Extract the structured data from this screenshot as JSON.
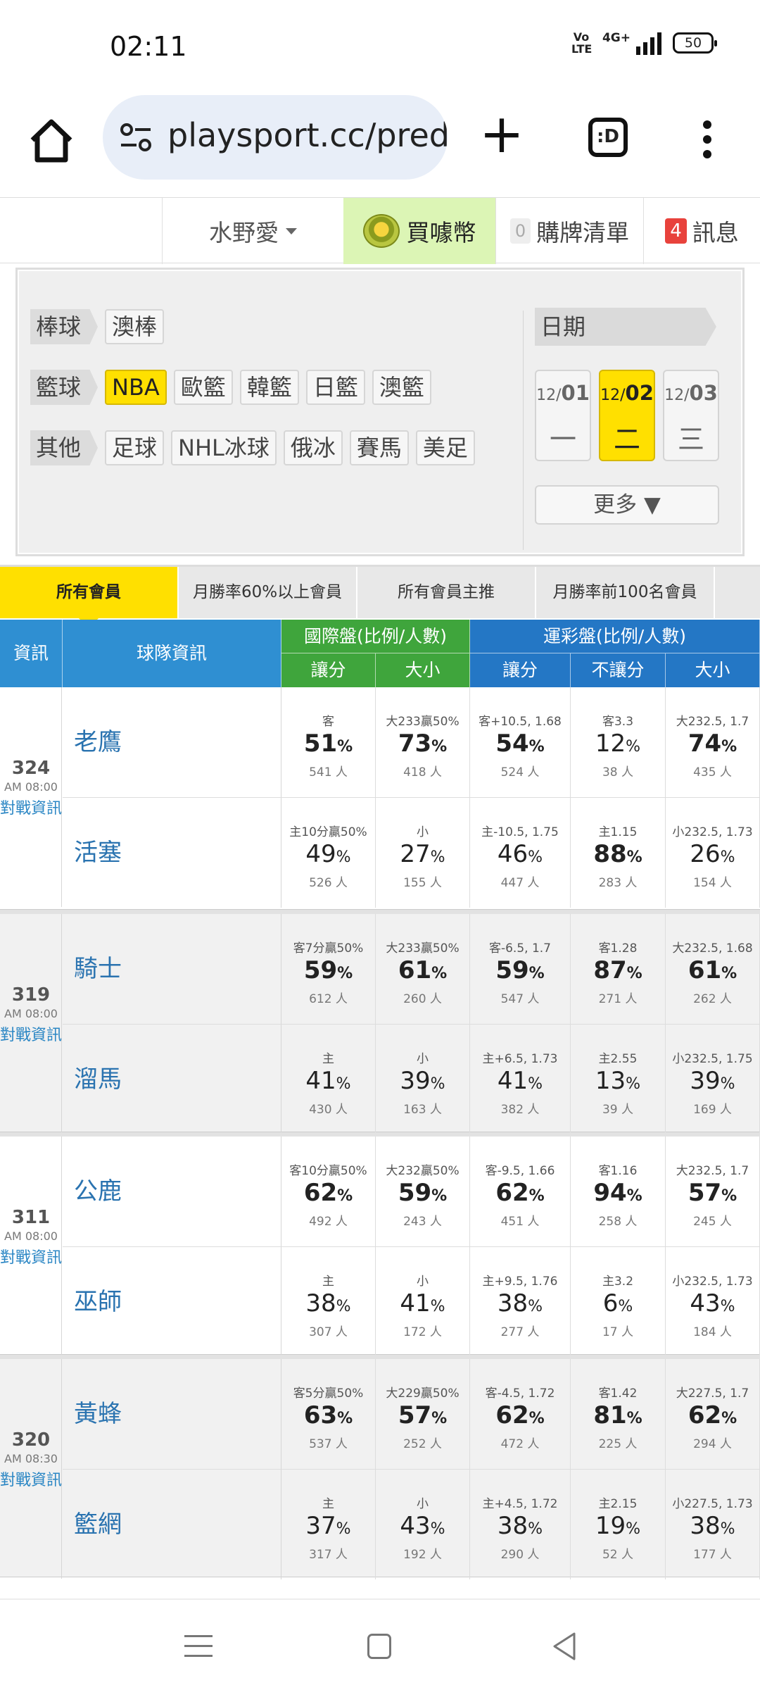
{
  "status_bar": {
    "time": "02:11",
    "network": "4G+",
    "volte": "Vo LTE",
    "battery": "50"
  },
  "browser": {
    "url": "playsport.cc/pred",
    "tabs_label": ":D"
  },
  "site_nav": {
    "user": "水野愛",
    "buy_coin": "買噱幣",
    "cart_count": "0",
    "cart_label": "購牌清單",
    "msg_count": "4",
    "msg_label": "訊息"
  },
  "filter": {
    "rows": [
      {
        "category": "棒球",
        "options": [
          {
            "label": "澳棒",
            "on": false
          }
        ]
      },
      {
        "category": "籃球",
        "options": [
          {
            "label": "NBA",
            "on": true
          },
          {
            "label": "歐籃",
            "on": false
          },
          {
            "label": "韓籃",
            "on": false
          },
          {
            "label": "日籃",
            "on": false
          },
          {
            "label": "澳籃",
            "on": false
          }
        ]
      },
      {
        "category": "其他",
        "options": [
          {
            "label": "足球",
            "on": false
          },
          {
            "label": "NHL冰球",
            "on": false
          },
          {
            "label": "俄冰",
            "on": false
          },
          {
            "label": "賽馬",
            "on": false
          },
          {
            "label": "美足",
            "on": false
          }
        ]
      }
    ],
    "date_header": "日期",
    "dates": [
      {
        "month": "12/",
        "day": "01",
        "weekday": "一",
        "on": false
      },
      {
        "month": "12/",
        "day": "02",
        "weekday": "二",
        "on": true
      },
      {
        "month": "12/",
        "day": "03",
        "weekday": "三",
        "on": false
      }
    ],
    "more_label": "更多 ▼"
  },
  "member_tabs": [
    {
      "label": "所有會員",
      "on": true
    },
    {
      "label": "月勝率60%以上會員",
      "on": false
    },
    {
      "label": "所有會員主推",
      "on": false
    },
    {
      "label": "月勝率前100名會員",
      "on": false
    }
  ],
  "table_header": {
    "info": "資訊",
    "team_info": "球隊資訊",
    "intl": "國際盤(比例/人數)",
    "lottery": "運彩盤(比例/人數)",
    "cols": [
      "讓分",
      "大小",
      "讓分",
      "不讓分",
      "大小"
    ]
  },
  "games": [
    {
      "num": "324",
      "time": "AM 08:00",
      "link": "對戰資訊",
      "teams": [
        {
          "name": "老鷹",
          "cells": [
            {
              "line": "客",
              "pct": "51",
              "count": "541 人",
              "bold": true
            },
            {
              "line": "大233贏50%",
              "pct": "73",
              "count": "418 人",
              "bold": true
            },
            {
              "line": "客+10.5, 1.68",
              "pct": "54",
              "count": "524 人",
              "bold": true
            },
            {
              "line": "客3.3",
              "pct": "12",
              "count": "38 人",
              "bold": false
            },
            {
              "line": "大232.5, 1.7",
              "pct": "74",
              "count": "435 人",
              "bold": true
            }
          ]
        },
        {
          "name": "活塞",
          "cells": [
            {
              "line": "主10分贏50%",
              "pct": "49",
              "count": "526 人",
              "bold": false
            },
            {
              "line": "小",
              "pct": "27",
              "count": "155 人",
              "bold": false
            },
            {
              "line": "主-10.5, 1.75",
              "pct": "46",
              "count": "447 人",
              "bold": false
            },
            {
              "line": "主1.15",
              "pct": "88",
              "count": "283 人",
              "bold": true
            },
            {
              "line": "小232.5, 1.73",
              "pct": "26",
              "count": "154 人",
              "bold": false
            }
          ]
        }
      ]
    },
    {
      "num": "319",
      "time": "AM 08:00",
      "link": "對戰資訊",
      "teams": [
        {
          "name": "騎士",
          "cells": [
            {
              "line": "客7分贏50%",
              "pct": "59",
              "count": "612 人",
              "bold": true
            },
            {
              "line": "大233贏50%",
              "pct": "61",
              "count": "260 人",
              "bold": true
            },
            {
              "line": "客-6.5, 1.7",
              "pct": "59",
              "count": "547 人",
              "bold": true
            },
            {
              "line": "客1.28",
              "pct": "87",
              "count": "271 人",
              "bold": true
            },
            {
              "line": "大232.5, 1.68",
              "pct": "61",
              "count": "262 人",
              "bold": true
            }
          ]
        },
        {
          "name": "溜馬",
          "cells": [
            {
              "line": "主",
              "pct": "41",
              "count": "430 人",
              "bold": false
            },
            {
              "line": "小",
              "pct": "39",
              "count": "163 人",
              "bold": false
            },
            {
              "line": "主+6.5, 1.73",
              "pct": "41",
              "count": "382 人",
              "bold": false
            },
            {
              "line": "主2.55",
              "pct": "13",
              "count": "39 人",
              "bold": false
            },
            {
              "line": "小232.5, 1.75",
              "pct": "39",
              "count": "169 人",
              "bold": false
            }
          ]
        }
      ]
    },
    {
      "num": "311",
      "time": "AM 08:00",
      "link": "對戰資訊",
      "teams": [
        {
          "name": "公鹿",
          "cells": [
            {
              "line": "客10分贏50%",
              "pct": "62",
              "count": "492 人",
              "bold": true
            },
            {
              "line": "大232贏50%",
              "pct": "59",
              "count": "243 人",
              "bold": true
            },
            {
              "line": "客-9.5, 1.66",
              "pct": "62",
              "count": "451 人",
              "bold": true
            },
            {
              "line": "客1.16",
              "pct": "94",
              "count": "258 人",
              "bold": true
            },
            {
              "line": "大232.5, 1.7",
              "pct": "57",
              "count": "245 人",
              "bold": true
            }
          ]
        },
        {
          "name": "巫師",
          "cells": [
            {
              "line": "主",
              "pct": "38",
              "count": "307 人",
              "bold": false
            },
            {
              "line": "小",
              "pct": "41",
              "count": "172 人",
              "bold": false
            },
            {
              "line": "主+9.5, 1.76",
              "pct": "38",
              "count": "277 人",
              "bold": false
            },
            {
              "line": "主3.2",
              "pct": "6",
              "count": "17 人",
              "bold": false
            },
            {
              "line": "小232.5, 1.73",
              "pct": "43",
              "count": "184 人",
              "bold": false
            }
          ]
        }
      ]
    },
    {
      "num": "320",
      "time": "AM 08:30",
      "link": "對戰資訊",
      "teams": [
        {
          "name": "黃蜂",
          "cells": [
            {
              "line": "客5分贏50%",
              "pct": "63",
              "count": "537 人",
              "bold": true
            },
            {
              "line": "大229贏50%",
              "pct": "57",
              "count": "252 人",
              "bold": true
            },
            {
              "line": "客-4.5, 1.72",
              "pct": "62",
              "count": "472 人",
              "bold": true
            },
            {
              "line": "客1.42",
              "pct": "81",
              "count": "225 人",
              "bold": true
            },
            {
              "line": "大227.5, 1.7",
              "pct": "62",
              "count": "294 人",
              "bold": true
            }
          ]
        },
        {
          "name": "籃網",
          "cells": [
            {
              "line": "主",
              "pct": "37",
              "count": "317 人",
              "bold": false
            },
            {
              "line": "小",
              "pct": "43",
              "count": "192 人",
              "bold": false
            },
            {
              "line": "主+4.5, 1.72",
              "pct": "38",
              "count": "290 人",
              "bold": false
            },
            {
              "line": "主2.15",
              "pct": "19",
              "count": "52 人",
              "bold": false
            },
            {
              "line": "小227.5, 1.73",
              "pct": "38",
              "count": "177 人",
              "bold": false
            }
          ]
        }
      ]
    }
  ],
  "colors": {
    "yellow": "#ffe000",
    "header_blue": "#2f8fd2",
    "header_green": "#3fa53c",
    "team_blue": "#2a73b0"
  }
}
